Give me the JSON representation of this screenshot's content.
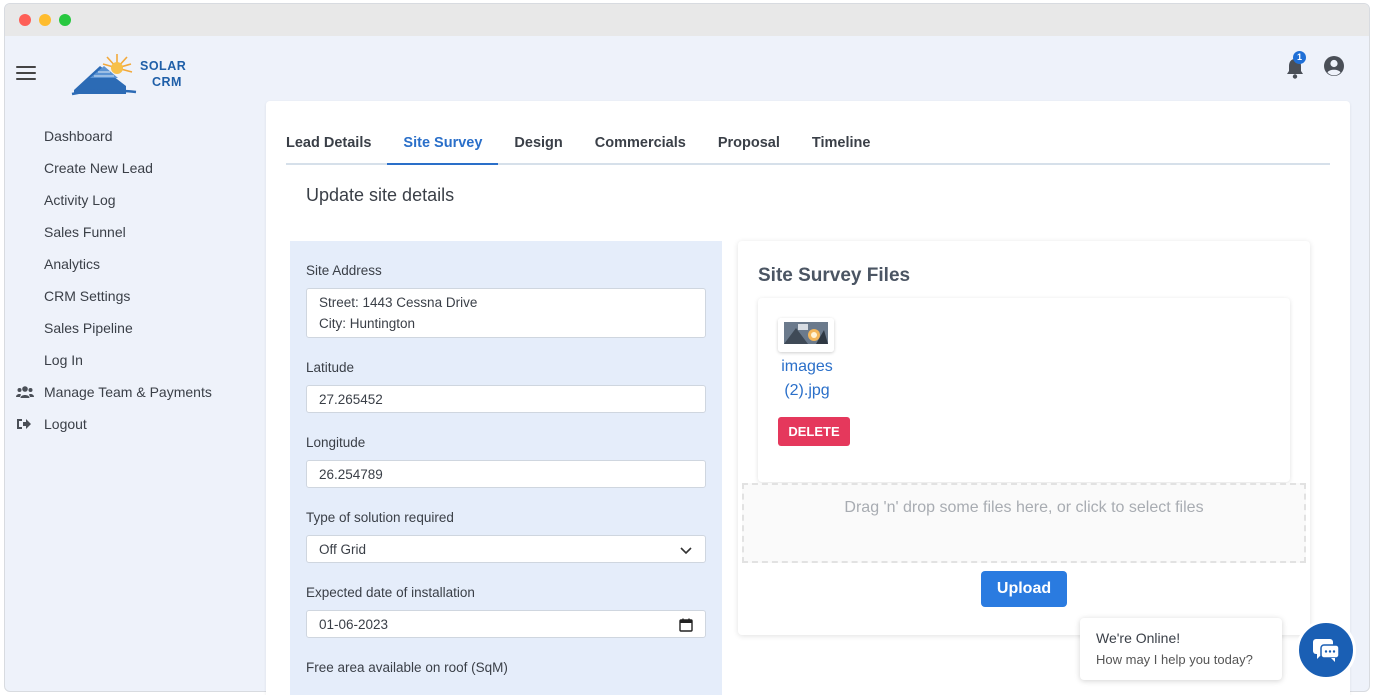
{
  "app": {
    "logo_line1": "SOLAR",
    "logo_line2": "CRM",
    "notification_count": "1",
    "brand_color": "#1f5fa8",
    "accent_color": "#2a6fc9"
  },
  "sidebar": {
    "items": [
      {
        "label": "Dashboard",
        "icon": ""
      },
      {
        "label": "Create New Lead",
        "icon": ""
      },
      {
        "label": "Activity Log",
        "icon": ""
      },
      {
        "label": "Sales Funnel",
        "icon": ""
      },
      {
        "label": "Analytics",
        "icon": ""
      },
      {
        "label": "CRM Settings",
        "icon": ""
      },
      {
        "label": "Sales Pipeline",
        "icon": ""
      },
      {
        "label": "Log In",
        "icon": ""
      },
      {
        "label": "Manage Team & Payments",
        "icon": "users-icon"
      },
      {
        "label": "Logout",
        "icon": "sign-out-icon"
      }
    ]
  },
  "tabs": [
    {
      "label": "Lead Details",
      "active": false
    },
    {
      "label": "Site Survey",
      "active": true
    },
    {
      "label": "Design",
      "active": false
    },
    {
      "label": "Commercials",
      "active": false
    },
    {
      "label": "Proposal",
      "active": false
    },
    {
      "label": "Timeline",
      "active": false
    }
  ],
  "page": {
    "section_title": "Update site details"
  },
  "form": {
    "site_address_label": "Site Address",
    "street_line": "Street:  1443 Cessna Drive",
    "city_line": "City:  Huntington",
    "latitude_label": "Latitude",
    "latitude_value": "27.265452",
    "longitude_label": "Longitude",
    "longitude_value": "26.254789",
    "solution_label": "Type of solution required",
    "solution_value": "Off Grid",
    "install_date_label": "Expected date of installation",
    "install_date_value": "01-06-2023",
    "roof_area_label": "Free area available on roof (SqM)"
  },
  "files": {
    "title": "Site Survey Files",
    "items": [
      {
        "name_line1": "images",
        "name_line2": "(2).jpg"
      }
    ],
    "delete_label": "DELETE",
    "dropzone_text": "Drag 'n' drop some files here, or click to select files",
    "upload_label": "Upload",
    "delete_color": "#e5385c",
    "upload_color": "#2a7be0"
  },
  "chat": {
    "line1": "We're Online!",
    "line2": "How may I help you today?"
  }
}
